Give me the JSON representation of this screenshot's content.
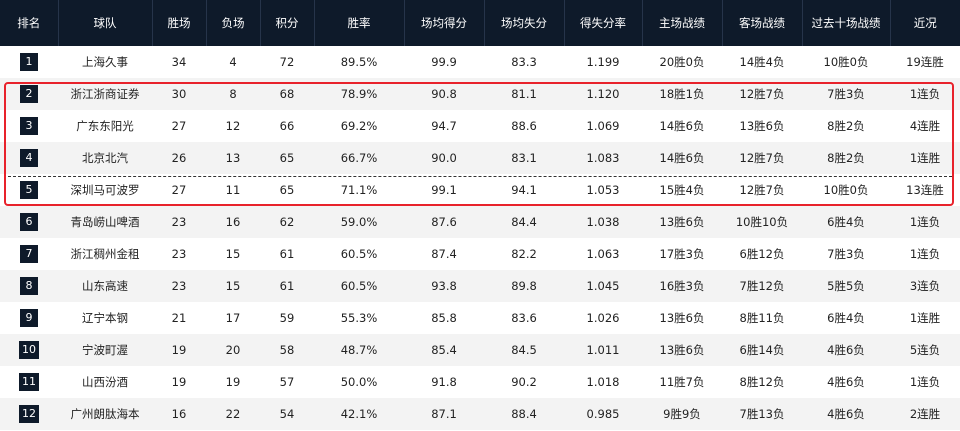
{
  "headers": [
    "排名",
    "球队",
    "胜场",
    "负场",
    "积分",
    "胜率",
    "场均得分",
    "场均失分",
    "得失分率",
    "主场战绩",
    "客场战绩",
    "过去十场战绩",
    "近况"
  ],
  "rows": [
    [
      "1",
      "上海久事",
      "34",
      "4",
      "72",
      "89.5%",
      "99.9",
      "83.3",
      "1.199",
      "20胜0负",
      "14胜4负",
      "10胜0负",
      "19连胜"
    ],
    [
      "2",
      "浙江浙商证券",
      "30",
      "8",
      "68",
      "78.9%",
      "90.8",
      "81.1",
      "1.120",
      "18胜1负",
      "12胜7负",
      "7胜3负",
      "1连负"
    ],
    [
      "3",
      "广东东阳光",
      "27",
      "12",
      "66",
      "69.2%",
      "94.7",
      "88.6",
      "1.069",
      "14胜6负",
      "13胜6负",
      "8胜2负",
      "4连胜"
    ],
    [
      "4",
      "北京北汽",
      "26",
      "13",
      "65",
      "66.7%",
      "90.0",
      "83.1",
      "1.083",
      "14胜6负",
      "12胜7负",
      "8胜2负",
      "1连胜"
    ],
    [
      "5",
      "深圳马可波罗",
      "27",
      "11",
      "65",
      "71.1%",
      "99.1",
      "94.1",
      "1.053",
      "15胜4负",
      "12胜7负",
      "10胜0负",
      "13连胜"
    ],
    [
      "6",
      "青岛崂山啤酒",
      "23",
      "16",
      "62",
      "59.0%",
      "87.6",
      "84.4",
      "1.038",
      "13胜6负",
      "10胜10负",
      "6胜4负",
      "1连负"
    ],
    [
      "7",
      "浙江稠州金租",
      "23",
      "15",
      "61",
      "60.5%",
      "87.4",
      "82.2",
      "1.063",
      "17胜3负",
      "6胜12负",
      "7胜3负",
      "1连负"
    ],
    [
      "8",
      "山东高速",
      "23",
      "15",
      "61",
      "60.5%",
      "93.8",
      "89.8",
      "1.045",
      "16胜3负",
      "7胜12负",
      "5胜5负",
      "3连负"
    ],
    [
      "9",
      "辽宁本钢",
      "21",
      "17",
      "59",
      "55.3%",
      "85.8",
      "83.6",
      "1.026",
      "13胜6负",
      "8胜11负",
      "6胜4负",
      "1连胜"
    ],
    [
      "10",
      "宁波町渥",
      "19",
      "20",
      "58",
      "48.7%",
      "85.4",
      "84.5",
      "1.011",
      "13胜6负",
      "6胜14负",
      "4胜6负",
      "5连负"
    ],
    [
      "11",
      "山西汾酒",
      "19",
      "19",
      "57",
      "50.0%",
      "91.8",
      "90.2",
      "1.018",
      "11胜7负",
      "8胜12负",
      "4胜6负",
      "1连负"
    ],
    [
      "12",
      "广州朗肽海本",
      "16",
      "22",
      "54",
      "42.1%",
      "87.1",
      "88.4",
      "0.985",
      "9胜9负",
      "7胜13负",
      "4胜6负",
      "2连胜"
    ]
  ],
  "colors": {
    "header_bg": "#0e1a2a",
    "highlight": "#e8222b",
    "stripe": "#f3f3f3"
  }
}
